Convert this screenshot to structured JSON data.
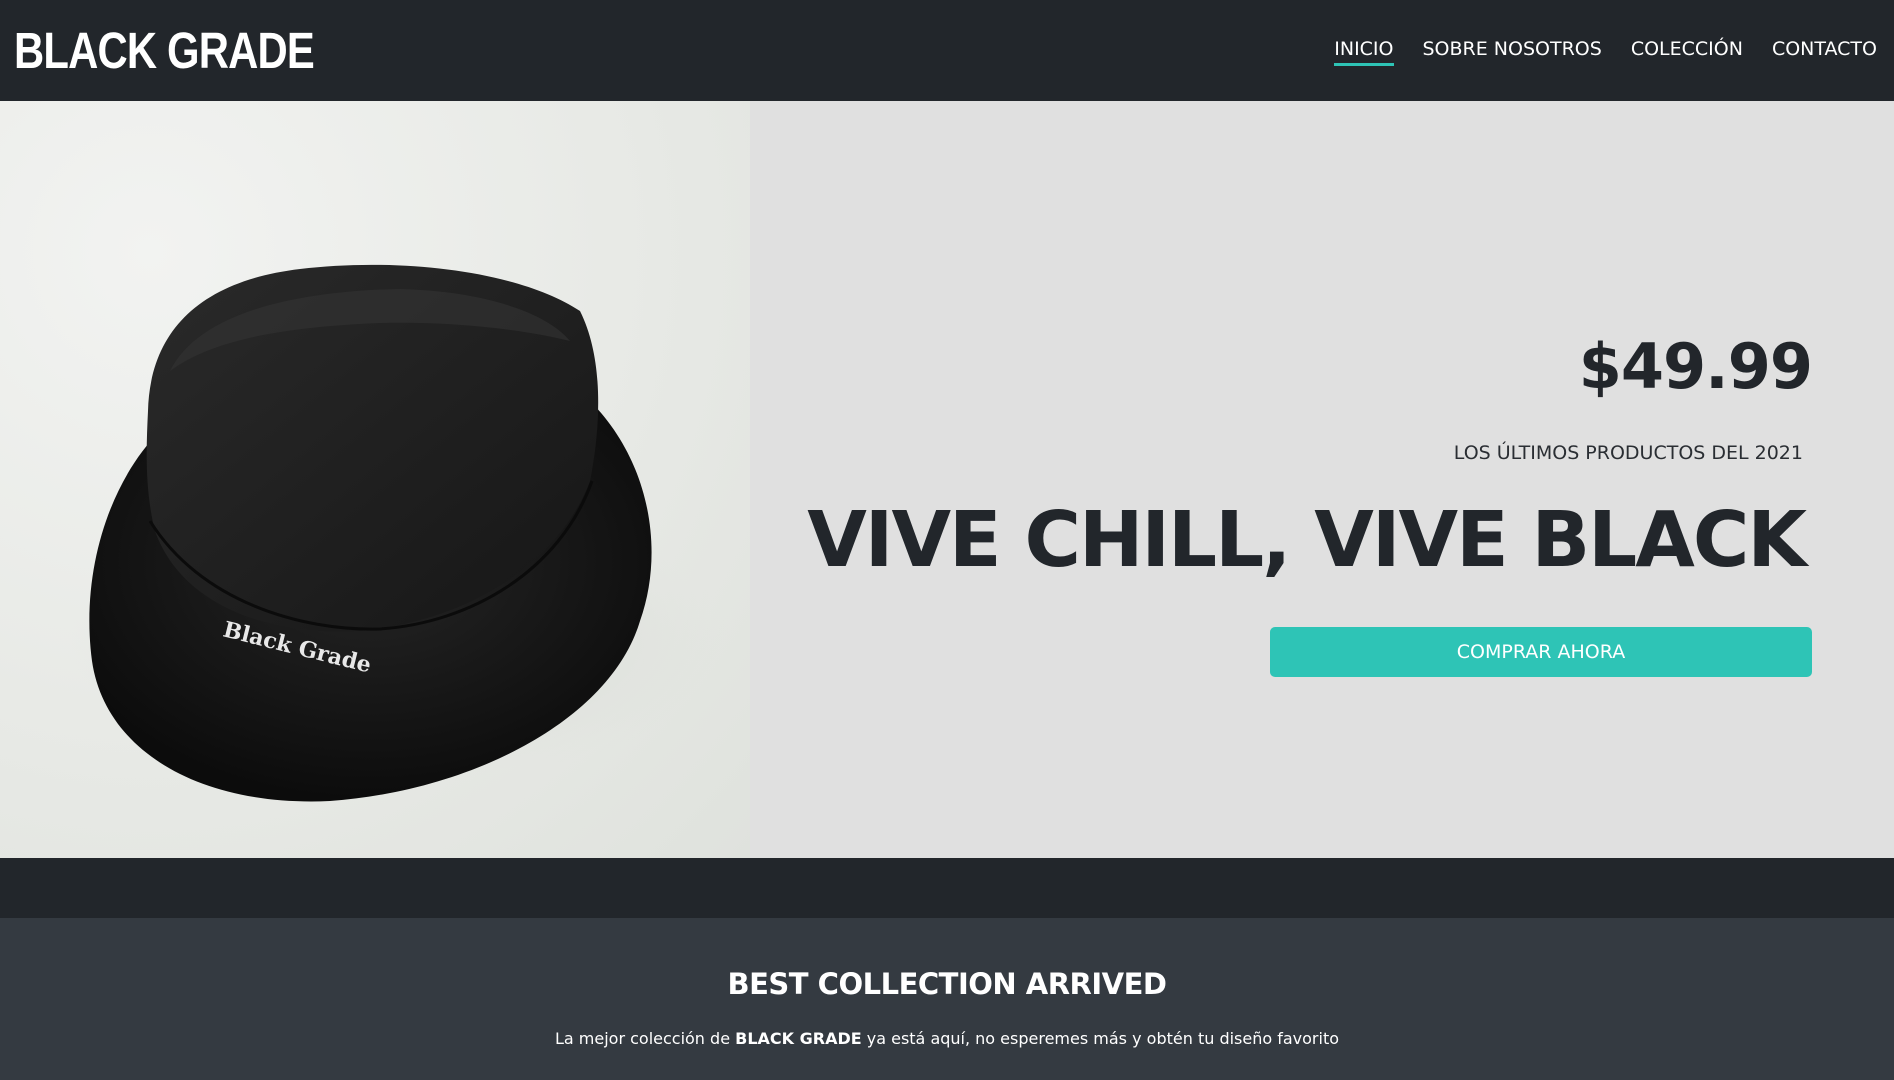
{
  "header": {
    "logo": "BLACK GRADE",
    "nav": [
      {
        "label": "INICIO",
        "active": true
      },
      {
        "label": "SOBRE NOSOTROS",
        "active": false
      },
      {
        "label": "COLECCIÓN",
        "active": false
      },
      {
        "label": "CONTACTO",
        "active": false
      }
    ]
  },
  "hero": {
    "image": {
      "icon": "bucket-hat-photo",
      "hat_text": "Black Grade"
    },
    "price": "$49.99",
    "subtitle": "LOS ÚLTIMOS PRODUCTOS DEL 2021",
    "headline": "VIVE CHILL, VIVE BLACK",
    "cta_label": "COMPRAR AHORA"
  },
  "collection": {
    "title": "BEST COLLECTION ARRIVED",
    "text_before": "La mejor colección de ",
    "text_brand": "BLACK GRADE",
    "text_after": " ya está aquí, no esperemes más y obtén tu diseño favorito"
  },
  "colors": {
    "dark": "#22262b",
    "section": "#343a41",
    "hero_bg": "#e0e0e0",
    "accent": "#2ec4b6"
  }
}
